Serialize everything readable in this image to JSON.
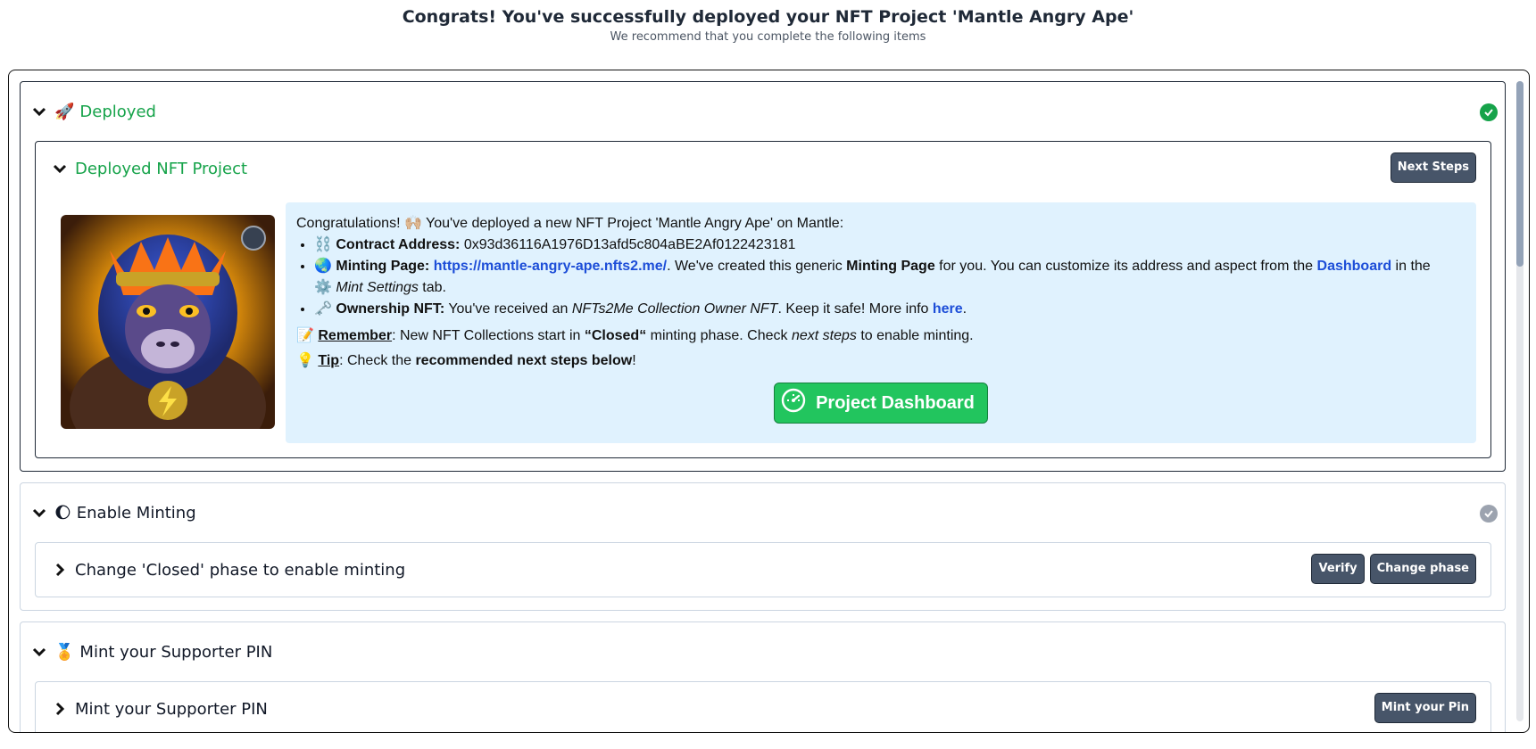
{
  "header": {
    "title": "Congrats! You've successfully deployed your NFT Project 'Mantle Angry Ape'",
    "subtitle": "We recommend that you complete the following items"
  },
  "sections": {
    "deployed": {
      "emoji": "🚀",
      "title": "Deployed",
      "subsection": {
        "title": "Deployed NFT Project",
        "next_steps_label": "Next Steps",
        "intro": "Congratulations! 🙌🏼 You've deployed a new NFT Project 'Mantle Angry Ape' on Mantle:",
        "contract": {
          "emoji": "⛓️",
          "label": "Contract Address:",
          "value": "0x93d36116A1976D13afd5c804aBE2Af0122423181"
        },
        "minting_page": {
          "emoji": "🌏",
          "label": "Minting Page:",
          "url": "https://mantle-angry-ape.nfts2.me/",
          "text1": ". We've created this generic ",
          "strong": "Minting Page",
          "text2": " for you. You can customize its address and aspect from the ",
          "dashboard_link": "Dashboard",
          "text3": " in the",
          "settings_emoji": "⚙️",
          "settings_label": "Mint Settings",
          "text4": " tab."
        },
        "ownership": {
          "emoji": "🗝️",
          "label": "Ownership NFT:",
          "text1": " You've received an ",
          "em": "NFTs2Me Collection Owner NFT",
          "text2": ". Keep it safe! More info ",
          "link": "here",
          "text3": "."
        },
        "remember": {
          "emoji": "📝",
          "label": "Remember",
          "text1": ": New NFT Collections start in ",
          "strong": "“Closed“",
          "text2": " minting phase. Check ",
          "em": "next steps",
          "text3": " to enable minting."
        },
        "tip": {
          "emoji": "💡",
          "label": "Tip",
          "text1": ": Check the ",
          "strong": "recommended next steps below",
          "text2": "!"
        },
        "dashboard_button": "Project Dashboard"
      }
    },
    "enable_minting": {
      "emoji": "🌔",
      "title": "Enable Minting",
      "subsection": {
        "title": "Change 'Closed' phase to enable minting",
        "verify_label": "Verify",
        "change_phase_label": "Change phase"
      }
    },
    "supporter_pin": {
      "emoji": "🏅",
      "title": "Mint your Supporter PIN",
      "subsection": {
        "title": "Mint your Supporter PIN",
        "button_label": "Mint your Pin"
      }
    }
  },
  "colors": {
    "success": "#16a34a",
    "button_dark": "#475569",
    "info_bg": "#e0f2fe",
    "link": "#1d4ed8",
    "dashboard_button": "#22c55e"
  }
}
